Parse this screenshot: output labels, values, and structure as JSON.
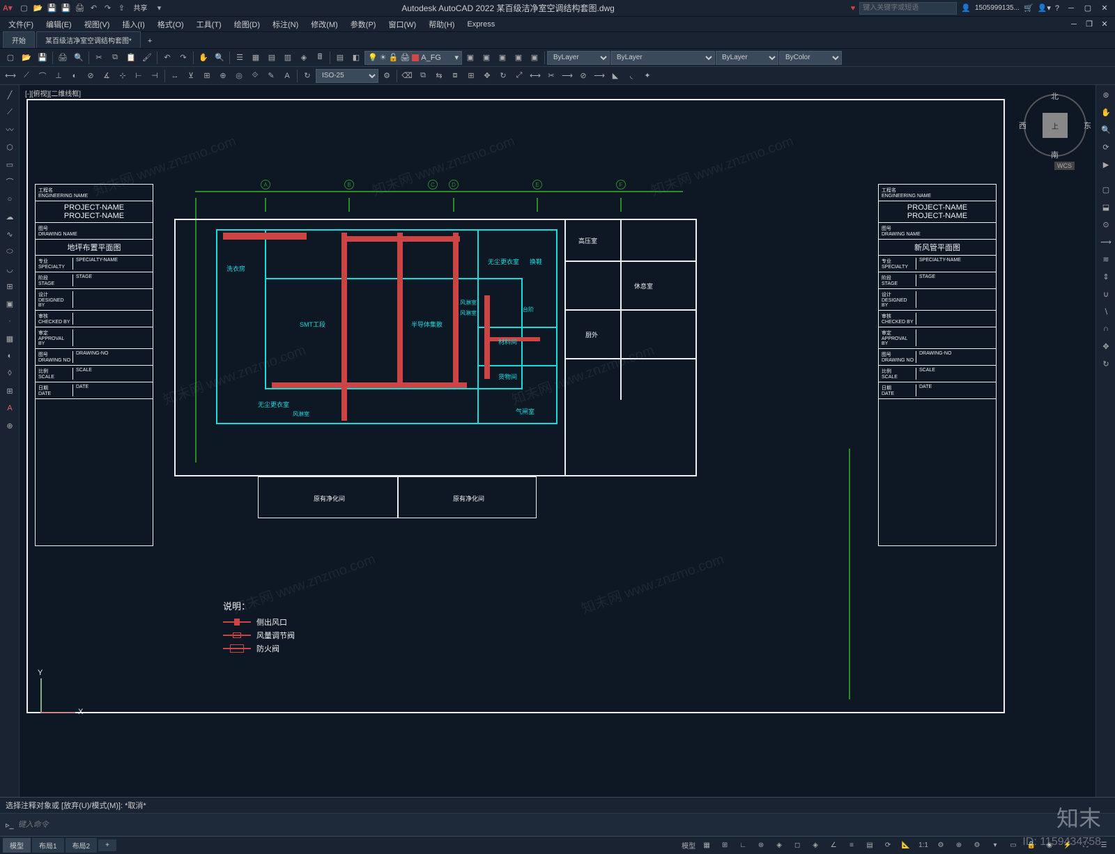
{
  "app": {
    "title": "Autodesk AutoCAD 2022    某百级洁净室空调结构套图.dwg",
    "search_placeholder": "键入关键字或短语",
    "username": "1505999135...",
    "share": "共享"
  },
  "menu": [
    "文件(F)",
    "编辑(E)",
    "视图(V)",
    "插入(I)",
    "格式(O)",
    "工具(T)",
    "绘图(D)",
    "标注(N)",
    "修改(M)",
    "参数(P)",
    "窗口(W)",
    "帮助(H)",
    "Express"
  ],
  "filetabs": {
    "start": "开始",
    "active": "某百级洁净室空调结构套图*",
    "add": "+"
  },
  "toolbar": {
    "layer_name": "A_FG",
    "bylayer1": "ByLayer",
    "bylayer2": "ByLayer",
    "bylayer3": "ByLayer",
    "bycolor": "ByColor",
    "iso25": "ISO-25"
  },
  "viewcube": {
    "top": "上",
    "n": "北",
    "s": "南",
    "e": "东",
    "w": "西",
    "wcs": "WCS"
  },
  "titleblock": {
    "eng_name_label": "工程名\nENGINEERING NAME",
    "project_name": "PROJECT-NAME\nPROJECT-NAME",
    "drawing_name_label": "图号\nDRAWING NAME",
    "drawing_name_left": "地坪布置平面图",
    "drawing_name_right": "新风管平面图",
    "specialty_l": "专业\nSPECIALTY",
    "specialty_v": "SPECIALTY-NAME",
    "stage_l": "阶段\nSTAGE",
    "stage_v": "STAGE",
    "designed_l": "设计\nDESIGNED BY",
    "checked_l": "审核\nCHECKED BY",
    "approval_l": "审定\nAPPROVAL BY",
    "drawing_no_l": "图号\nDRAWING NO",
    "drawing_no_v": "DRAWING-NO",
    "scale_l": "比例\nSCALE",
    "scale_v": "SCALE",
    "date_l": "日期\nDATE",
    "date_v": "DATE"
  },
  "rooms": {
    "laundry": "洗衣房",
    "smt": "SMT工段",
    "semi": "半导体集散",
    "fengji": "风淋室",
    "fengji2": "风淋室",
    "wujun1": "无尘更衣室",
    "wujun2": "无尘更衣室",
    "cailiao": "材料间",
    "huowu": "货物间",
    "qimi": "气闸室",
    "huanxie": "换鞋",
    "gaoya": "高压室",
    "xiuxi": "休息室",
    "chufang": "厨外",
    "yuanjing1": "原有净化间",
    "yuanjing2": "原有净化间",
    "taidi": "台阶"
  },
  "legend": {
    "title": "说明：",
    "item1": "侧出风口",
    "item2": "风量调节阀",
    "item3": "防火阀"
  },
  "grid_labels": [
    "A",
    "B",
    "C",
    "D",
    "E",
    "F"
  ],
  "command": {
    "history": "选择注释对象或 [放弃(U)/模式(M)]: *取消*",
    "prompt": "键入命令"
  },
  "statusbar": {
    "tabs": [
      "模型",
      "布局1",
      "布局2"
    ],
    "scale": "1:1",
    "add": "+"
  },
  "ucs": {
    "x": "X",
    "y": "Y"
  },
  "watermark": {
    "text": "知末网 www.znzmo.com",
    "brand": "知末",
    "id": "ID: 1159434758"
  },
  "model_tab_label": "[-][俯视][二维线框]"
}
